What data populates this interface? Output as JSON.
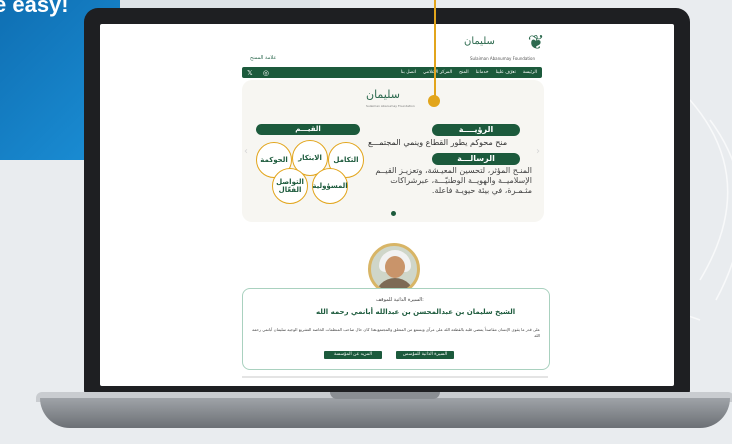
{
  "banner": {
    "tagline": "e easy!"
  },
  "site": {
    "logo_text": "سليمان",
    "logo_subtitle": "Sulaiman Abanumay Foundation",
    "brand_label": "علامة الممنح",
    "nav": {
      "items": [
        "الرئيسة",
        "تعرّف علينا",
        "خدماتنا",
        "المنح",
        "المركز الإعلامي",
        "اتصل بنا"
      ],
      "icons": "𝕏 ◎"
    }
  },
  "hero": {
    "logo_text": "سليمان",
    "logo_subtitle": "Sulaiman Abanumay Foundation",
    "vision_title": "الرؤيــــة",
    "vision_text": "منح محوكم يطور القطاع وينمي المجتمـــع",
    "mission_title": "الرسالـــة",
    "mission_text": "المنـح المؤثر، لتحسين المعيـشة، وتعزيـز القيــم الإسلاميــة والهويــة الوطنيّـــة، عبرشراكات مثـمـرة، في بيئة حيويـة فاعلة.",
    "values_title": "القيـــم",
    "values": [
      "الحوكمة",
      "الابتكار",
      "التكامل",
      "المسؤولية",
      "التواصل الفعّال"
    ],
    "prev_arrow": "‹",
    "next_arrow": "›"
  },
  "founder": {
    "label": "السيرة الذاتية للموقف:",
    "name": "الشيخ سليمان بن عبدالمحسن بن عبدالله أبانمي رحمه الله",
    "bio": "على قدر ما يقوى الإنسان مقاصداً يمضي قلبه بالقطعة الله على مرآى ويسمع من المتعلق والمجتمع،هذا كان حال صاحب المنظمات الخاصة التشريع الوجيه سليمان أبانمي رحمه الله",
    "buttons": [
      "السيرة الذاتية للمؤسس",
      "المزيد عن المؤسسة"
    ]
  }
}
